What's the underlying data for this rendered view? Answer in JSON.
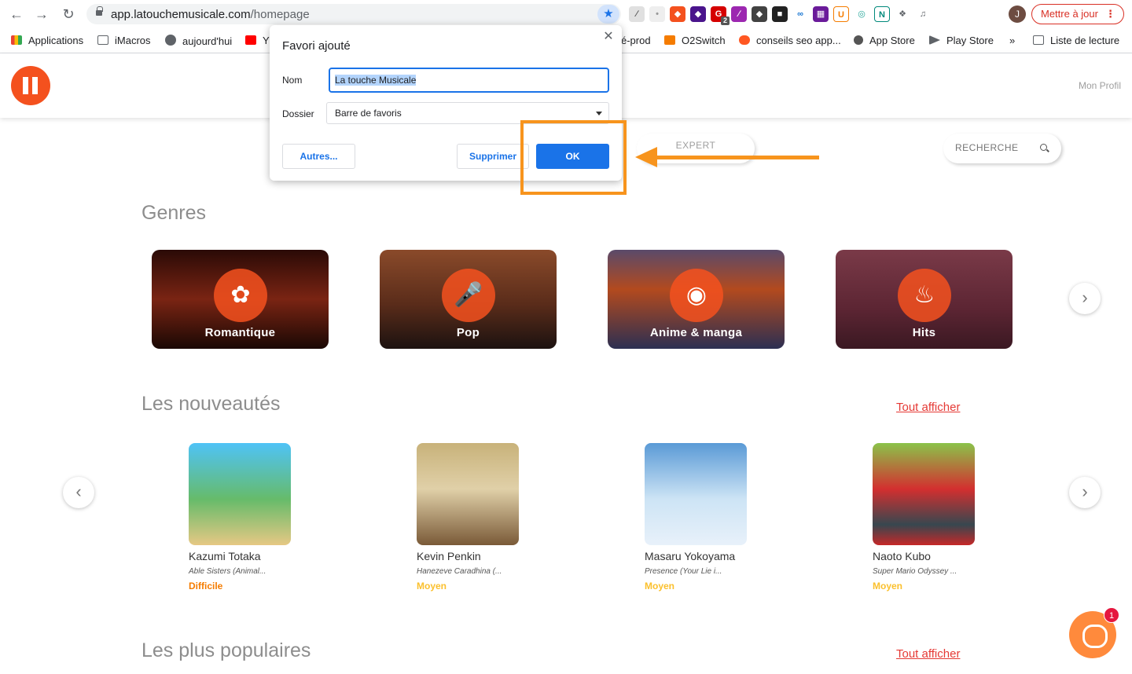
{
  "browser": {
    "url_host": "app.latouchemusicale.com",
    "url_path": "/homepage",
    "avatar_letter": "J",
    "update_label": "Mettre à jour",
    "bookmarks": [
      {
        "label": "Applications",
        "icon": "apps-grid-icon"
      },
      {
        "label": "iMacros",
        "icon": "folder-icon"
      },
      {
        "label": "aujourd'hui",
        "icon": "globe-icon"
      },
      {
        "label": "Y",
        "icon": "youtube-icon"
      },
      {
        "label": "é-prod",
        "icon": "none"
      },
      {
        "label": "O2Switch",
        "icon": "o2switch-icon"
      },
      {
        "label": "conseils seo app...",
        "icon": "semrush-icon"
      },
      {
        "label": "App Store",
        "icon": "apple-icon"
      },
      {
        "label": "Play Store",
        "icon": "play-icon"
      },
      {
        "label": "»",
        "icon": "none"
      },
      {
        "label": "Liste de lecture",
        "icon": "reading-list-icon"
      }
    ],
    "extension_badge": "2"
  },
  "dialog": {
    "title": "Favori ajouté",
    "name_label": "Nom",
    "name_value": "La touche Musicale",
    "folder_label": "Dossier",
    "folder_value": "Barre de favoris",
    "other_button": "Autres...",
    "delete_button": "Supprimer",
    "ok_button": "OK"
  },
  "app": {
    "profile_link": "Mon Profil",
    "expert_tab": "EXPERT",
    "search_label": "RECHERCHE",
    "genres_title": "Genres",
    "genres": [
      {
        "label": "Romantique",
        "icon": "rose-icon",
        "bg": "#5a1a12"
      },
      {
        "label": "Pop",
        "icon": "microphone-icon",
        "bg": "#6e3a22"
      },
      {
        "label": "Anime & manga",
        "icon": "pokeball-icon",
        "bg": "#3d3f5c"
      },
      {
        "label": "Hits",
        "icon": "flame-icon",
        "bg": "#6b2b3a"
      }
    ],
    "new_title": "Les nouveautés",
    "see_all": "Tout afficher",
    "songs": [
      {
        "artist": "Kazumi Totaka",
        "title": "Able Sisters (Animal...",
        "level": "Difficile",
        "level_color": "#f57c00",
        "cover": "#4fa84a"
      },
      {
        "artist": "Kevin Penkin",
        "title": "Hanezeve Caradhina (...",
        "level": "Moyen",
        "level_color": "#fbc02d",
        "cover": "#b39a6b"
      },
      {
        "artist": "Masaru Yokoyama",
        "title": "Presence (Your Lie i...",
        "level": "Moyen",
        "level_color": "#fbc02d",
        "cover": "#7fb2dc"
      },
      {
        "artist": "Naoto Kubo",
        "title": "Super Mario Odyssey ...",
        "level": "Moyen",
        "level_color": "#fbc02d",
        "cover": "#c62828"
      }
    ],
    "popular_title": "Les plus populaires",
    "chat_badge": "1"
  }
}
